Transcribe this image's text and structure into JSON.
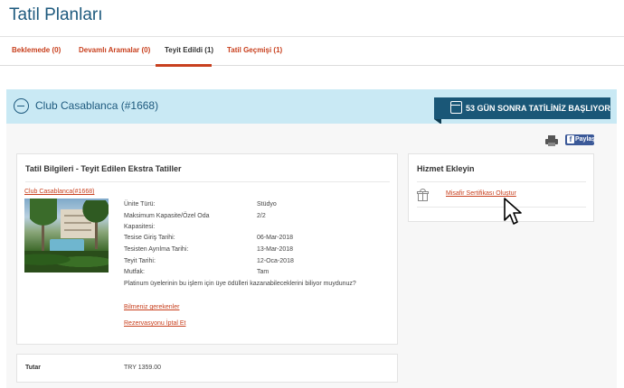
{
  "page": {
    "title": "Tatil Planları"
  },
  "tabs": [
    {
      "label": "Beklemede (0)"
    },
    {
      "label": "Devamlı Aramalar (0)"
    },
    {
      "label": "Teyit Edildi (1)"
    },
    {
      "label": "Tatil Geçmişi (1)"
    }
  ],
  "active_tab_index": 2,
  "hotel_bar": {
    "name": "Club Casablanca (#1668)",
    "countdown": "53 GÜN SONRA TATİLİNİZ BAŞLIYOR"
  },
  "actions": {
    "print_icon": "printer-icon",
    "share_label": "Paylaş",
    "share_icon": "facebook-icon"
  },
  "vacation_info": {
    "title": "Tatil Bilgileri - Teyit Edilen Ekstra Tatiller",
    "hotel_link": "Club Casablanca(#1668)",
    "details": [
      {
        "label": "Ünite Türü:",
        "value": "Stüdyo"
      },
      {
        "label": "Maksimum Kapasite/Özel Oda",
        "value": "2/2"
      },
      {
        "label": "Kapasitesi:",
        "value": ""
      },
      {
        "label": "Tesise Giriş Tarihi:",
        "value": "06-Mar-2018"
      },
      {
        "label": "Tesisten Ayrılma Tarihi:",
        "value": "13-Mar-2018"
      },
      {
        "label": "Teyit Tarihi:",
        "value": "12-Oca-2018"
      },
      {
        "label": "Mutfak:",
        "value": "Tam"
      }
    ],
    "note": "Platinum üyelerinin bu işlem için üye ödülleri kazanabileceklerini biliyor muydunuz?",
    "link_info": "Bilmeniz gerekenler",
    "link_cancel": "Rezervasyonu İptal Et"
  },
  "services": {
    "title": "Hizmet Ekleyin",
    "gift_icon": "gift-icon",
    "certificate_link": "Misafir Sertifikası Oluştur"
  },
  "total": {
    "label": "Tutar",
    "value": "TRY 1359.00"
  },
  "colors": {
    "accent": "#c8401e",
    "title_blue": "#1e5a7e",
    "hotel_bar_bg": "#c9e9f4",
    "countdown_bg": "#1a5777"
  }
}
